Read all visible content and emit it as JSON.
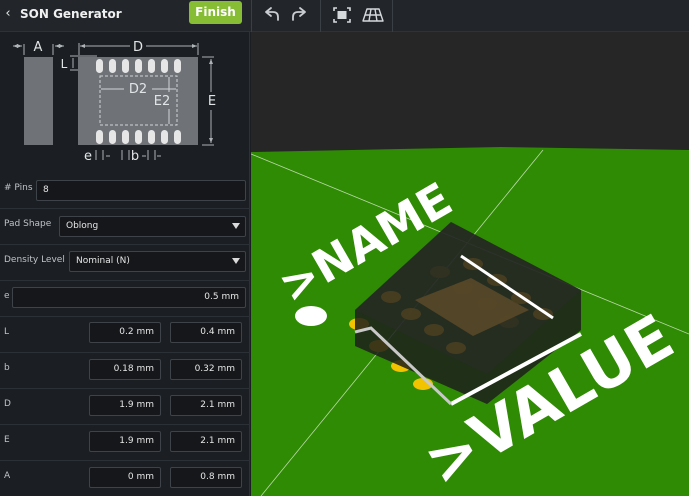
{
  "header": {
    "back_icon": "chevron-left-icon",
    "title": "SON Generator",
    "finish_label": "Finish",
    "tools": [
      "undo-icon",
      "redo-icon",
      "fit-view-icon",
      "grid-plane-icon"
    ]
  },
  "diagram": {
    "labels": {
      "A": "A",
      "D": "D",
      "L": "L",
      "D2": "D2",
      "E2": "E2",
      "E": "E",
      "e": "e",
      "b": "b"
    }
  },
  "form": {
    "pins": {
      "label": "# Pins",
      "value": "8"
    },
    "pad_shape": {
      "label": "Pad Shape",
      "value": "Oblong"
    },
    "density": {
      "label": "Density Level",
      "value": "Nominal (N)"
    },
    "e": {
      "label": "e",
      "value": "0.5 mm"
    },
    "L": {
      "label": "L",
      "min": "0.2 mm",
      "max": "0.4 mm"
    },
    "b": {
      "label": "b",
      "min": "0.18 mm",
      "max": "0.32 mm"
    },
    "D": {
      "label": "D",
      "min": "1.9 mm",
      "max": "2.1 mm"
    },
    "E": {
      "label": "E",
      "min": "1.9 mm",
      "max": "2.1 mm"
    },
    "A": {
      "label": "A",
      "min": "0 mm",
      "max": "0.8 mm"
    }
  },
  "view3d": {
    "name_text": ">NAME",
    "value_text": ">VALUE",
    "colors": {
      "board": "#2f8a04",
      "pad": "#f2c300",
      "body": "#1d1f1c",
      "silk": "#ffffff",
      "sky": "#262626"
    }
  }
}
